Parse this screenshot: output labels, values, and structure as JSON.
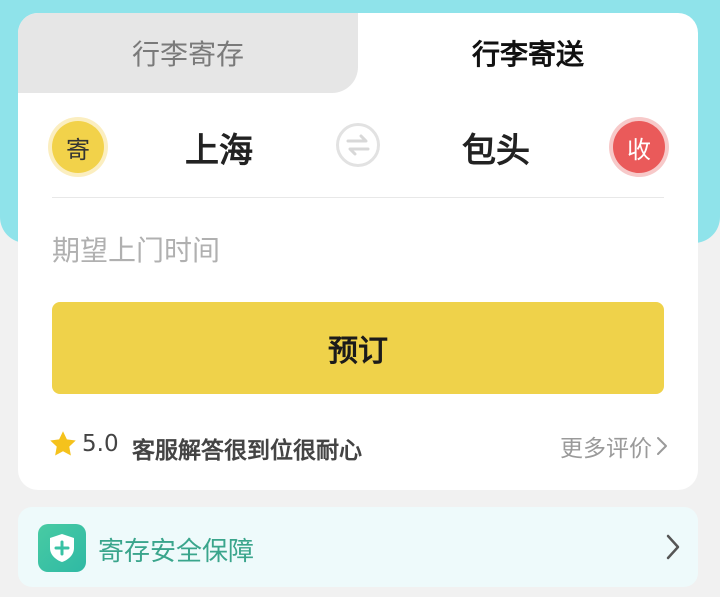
{
  "tabs": {
    "storage_label": "行李寄存",
    "delivery_label": "行李寄送"
  },
  "route": {
    "send_badge": "寄",
    "from_city": "上海",
    "to_city": "包头",
    "receive_badge": "收",
    "swap_icon": "swap-icon"
  },
  "booking": {
    "time_placeholder": "期望上门时间",
    "book_label": "预订"
  },
  "review": {
    "rating": "5.0",
    "text": "客服解答很到位很耐心",
    "more_label": "更多评价"
  },
  "banner": {
    "label": "寄存安全保障"
  },
  "colors": {
    "hero": "#8fe3ea",
    "button": "#efd24a",
    "send_badge": "#f2d24a",
    "receive_badge": "#ea5a5a",
    "banner_text": "#3aa58c"
  }
}
